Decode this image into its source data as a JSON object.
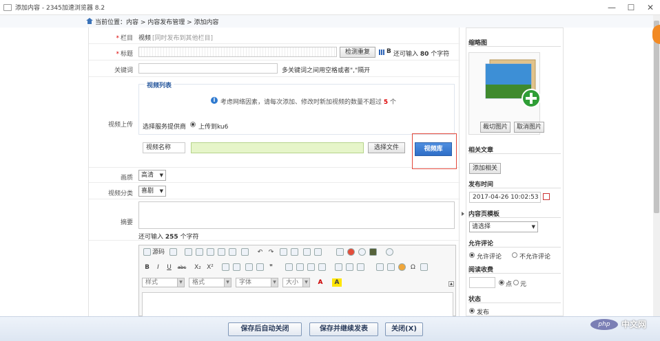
{
  "window": {
    "title": "添加内容 - 2345加速浏览器 8.2",
    "minimize": "—",
    "maximize": "☐",
    "close": "✕"
  },
  "breadcrumb": "当前位置：内容 > 内容发布管理 > 添加内容",
  "form": {
    "column": {
      "label": "栏目",
      "value": "视频",
      "hint": "[同时发布到其他栏目]"
    },
    "title": {
      "label": "标题",
      "check_btn": "检测重复",
      "bold_icon": "B",
      "remain_pre": "还可输入",
      "remain_num": "80",
      "remain_post": "个字符"
    },
    "keywords": {
      "label": "关键词",
      "hint": "多关键词之间用空格或者\",\"隔开"
    },
    "upload": {
      "label": "视频上传",
      "legend": "视频列表",
      "info_pre": "考虑网络因素，请每次添加、修改时新加视频的数量不超过",
      "info_num": "5",
      "info_post": "个",
      "provider_label": "选择服务提供商",
      "provider_option": "上传到ku6",
      "name_field": "视频名称",
      "choose_file": "选择文件",
      "video_lib": "视频库"
    },
    "quality": {
      "label": "画质",
      "value": "高清"
    },
    "category": {
      "label": "视频分类",
      "value": "喜剧"
    },
    "summary": {
      "label": "摘要",
      "remain_pre": "还可输入",
      "remain_num": "255",
      "remain_post": "个字符"
    }
  },
  "editor": {
    "source_label": "源码",
    "style_combo": "样式",
    "format_combo": "格式",
    "font_combo": "字体",
    "size_combo": "大小",
    "bold": "B",
    "italic": "I",
    "underline": "U",
    "strike": "abc",
    "subscript": "X₂",
    "superscript": "X²",
    "quote": "❞",
    "omega": "Ω",
    "text_color": "A",
    "bg_color": "A"
  },
  "side": {
    "thumb_title": "缩略图",
    "crop_btn": "裁切图片",
    "cancel_btn": "取消图片",
    "related_title": "相关文章",
    "add_related_btn": "添加相关",
    "pubtime_title": "发布时间",
    "pubtime_value": "2017-04-26 10:02:53",
    "template_title": "内容页模板",
    "template_value": "请选择",
    "comment_title": "允许评论",
    "comment_yes": "允许评论",
    "comment_no": "不允许评论",
    "fee_title": "阅读收费",
    "fee_point": "点",
    "fee_yuan": "元",
    "status_title": "状态",
    "status_publish": "发布"
  },
  "bottom": {
    "save_close": "保存后自动关闭",
    "save_continue": "保存并继续发表",
    "close": "关闭(X)"
  },
  "watermark": {
    "logo": "php",
    "text": "中文网"
  }
}
